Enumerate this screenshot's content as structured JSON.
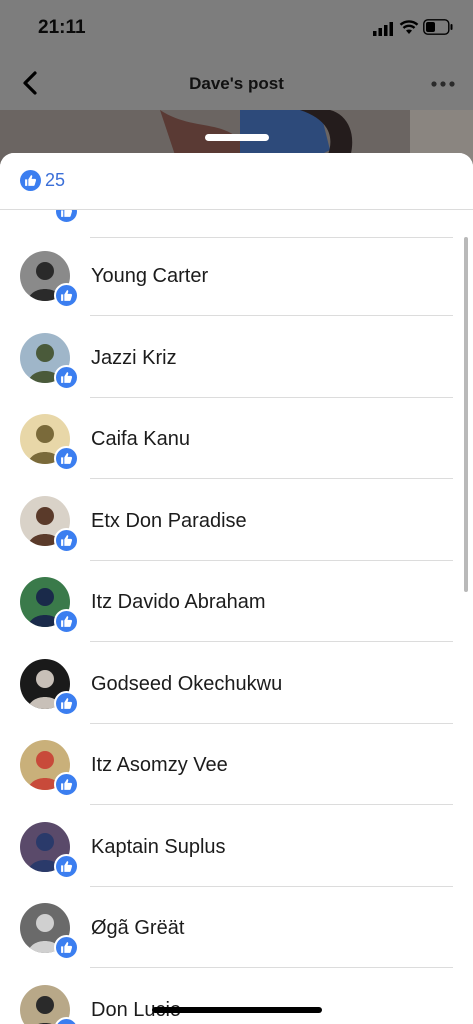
{
  "status": {
    "time": "21:11"
  },
  "nav": {
    "title": "Dave's post"
  },
  "reactions": {
    "count": "25"
  },
  "likers": [
    {
      "name": "Young Carter",
      "bg": "#8a8a8a",
      "fg": "#2a2a2a"
    },
    {
      "name": "Jazzi Kriz",
      "bg": "#9fb6c9",
      "fg": "#4a5a3a"
    },
    {
      "name": "Caifa Kanu",
      "bg": "#e8d7a8",
      "fg": "#7a6a3a"
    },
    {
      "name": "Etx Don Paradise",
      "bg": "#d9d2c8",
      "fg": "#5a3a2a"
    },
    {
      "name": "Itz Davido Abraham",
      "bg": "#3a7a4a",
      "fg": "#1a2a4a"
    },
    {
      "name": "Godseed Okechukwu",
      "bg": "#1a1a1a",
      "fg": "#c8c0b8"
    },
    {
      "name": "Itz Asomzy Vee",
      "bg": "#c9b07a",
      "fg": "#c84a3a"
    },
    {
      "name": "Kaptain Suplus",
      "bg": "#5a4a6a",
      "fg": "#2a3a6a"
    },
    {
      "name": "Øgã Grëät",
      "bg": "#6a6a6a",
      "fg": "#d0d0d0"
    },
    {
      "name": "Don Lucio",
      "bg": "#b8a888",
      "fg": "#2a2a2a"
    }
  ]
}
